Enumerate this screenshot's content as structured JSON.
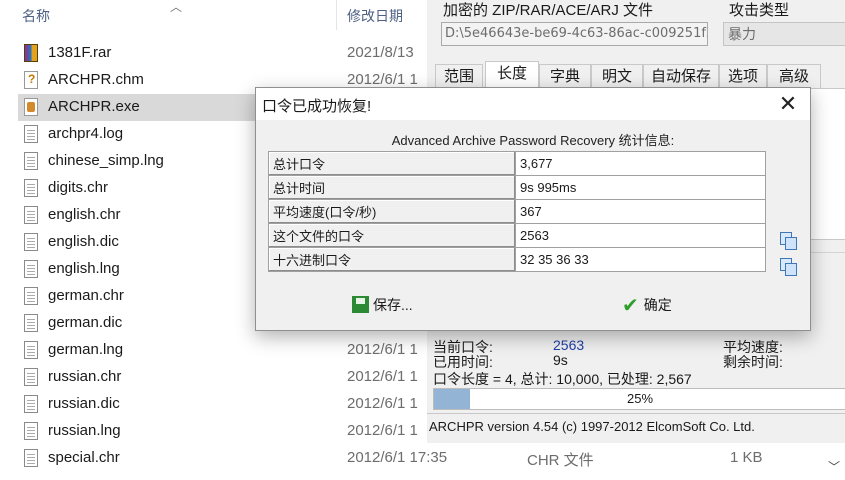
{
  "explorer": {
    "columns": {
      "name": "名称",
      "modified": "修改日期"
    },
    "files": [
      {
        "name": "1381F.rar",
        "date": "2021/8/13",
        "type": "",
        "size": "",
        "icon": "winrar-archive-icon"
      },
      {
        "name": "ARCHPR.chm",
        "date": "2012/6/1 1",
        "type": "",
        "size": "",
        "icon": "chm-help-icon"
      },
      {
        "name": "ARCHPR.exe",
        "date": "",
        "type": "",
        "size": "",
        "icon": "archpr-exe-icon"
      },
      {
        "name": "archpr4.log",
        "date": "",
        "type": "",
        "size": "",
        "icon": "text-file-icon"
      },
      {
        "name": "chinese_simp.lng",
        "date": "",
        "type": "",
        "size": "",
        "icon": "text-file-icon"
      },
      {
        "name": "digits.chr",
        "date": "",
        "type": "",
        "size": "",
        "icon": "text-file-icon"
      },
      {
        "name": "english.chr",
        "date": "",
        "type": "",
        "size": "",
        "icon": "text-file-icon"
      },
      {
        "name": "english.dic",
        "date": "",
        "type": "",
        "size": "",
        "icon": "text-file-icon"
      },
      {
        "name": "english.lng",
        "date": "",
        "type": "",
        "size": "",
        "icon": "text-file-icon"
      },
      {
        "name": "german.chr",
        "date": "",
        "type": "",
        "size": "",
        "icon": "text-file-icon"
      },
      {
        "name": "german.dic",
        "date": "2012/6/1",
        "type": "",
        "size": "",
        "icon": "text-file-icon"
      },
      {
        "name": "german.lng",
        "date": "2012/6/1 1",
        "type": "",
        "size": "",
        "icon": "text-file-icon"
      },
      {
        "name": "russian.chr",
        "date": "2012/6/1 1",
        "type": "",
        "size": "",
        "icon": "text-file-icon"
      },
      {
        "name": "russian.dic",
        "date": "2012/6/1 1",
        "type": "",
        "size": "",
        "icon": "text-file-icon"
      },
      {
        "name": "russian.lng",
        "date": "2012/6/1 1",
        "type": "",
        "size": "",
        "icon": "text-file-icon"
      },
      {
        "name": "special.chr",
        "date": "2012/6/1 17:35",
        "type": "CHR 文件",
        "size": "1 KB",
        "icon": "text-file-icon"
      }
    ],
    "selected_index": 2
  },
  "archpr": {
    "encrypted_file_label": "加密的 ZIP/RAR/ACE/ARJ 文件",
    "encrypted_file_path": "D:\\5e46643e-be69-4c63-86ac-c009251f2",
    "attack_type_label": "攻击类型",
    "attack_type_value": "暴力",
    "tabs": [
      "范围",
      "长度",
      "字典",
      "明文",
      "自动保存",
      "选项",
      "高级"
    ],
    "active_tab": 1,
    "status": {
      "current_password_label": "当前口令:",
      "current_password_value": "2563",
      "elapsed_label": "已用时间:",
      "elapsed_value": "9s",
      "avg_speed_label": "平均速度:",
      "remaining_label": "剩余时间:",
      "length_line": "口令长度 = 4, 总计: 10,000, 已处理: 2,567",
      "progress_percent": 25,
      "progress_text": "25%"
    },
    "statusbar": "ARCHPR version 4.54 (c) 1997-2012 ElcomSoft Co. Ltd."
  },
  "dialog": {
    "title": "口令已成功恢复!",
    "heading": "Advanced Archive Password Recovery 统计信息:",
    "rows": [
      {
        "label": "总计口令",
        "value": "3,677",
        "copyable": false
      },
      {
        "label": "总计时间",
        "value": "9s 995ms",
        "copyable": false
      },
      {
        "label": "平均速度(口令/秒)",
        "value": "367",
        "copyable": false
      },
      {
        "label": "这个文件的口令",
        "value": "2563",
        "copyable": true
      },
      {
        "label": "十六进制口令",
        "value": "32 35 36 33",
        "copyable": true
      }
    ],
    "save_label": "保存...",
    "ok_label": "确定",
    "colors": {
      "ok_check": "#2e9e2e",
      "save_icon": "#2c8a35",
      "link_value": "#1f3fa8"
    }
  }
}
